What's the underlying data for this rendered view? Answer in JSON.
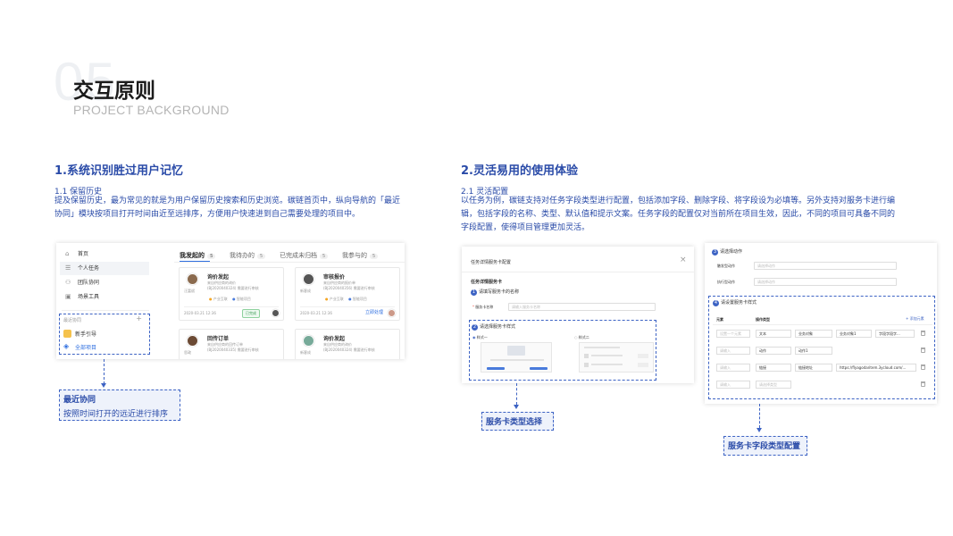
{
  "header": {
    "number": "05",
    "title": "交互原则",
    "subtitle": "PROJECT BACKGROUND"
  },
  "left": {
    "heading": "1.系统识别胜过用户记忆",
    "sub": "1.1 保留历史",
    "desc": "提及保留历史，最为常见的就是为用户保留历史搜索和历史浏览。碳链首页中，纵向导航的「最近协同」模块按项目打开时间由近至远排序，方便用户快速进到自己需要处理的项目中。",
    "callout": {
      "title": "最近协同",
      "text": "按照时间打开的远近进行排序"
    }
  },
  "ui1": {
    "nav": [
      "首页",
      "个人任务",
      "团队协同",
      "场景工具"
    ],
    "recent_label": "最近协同",
    "recent_add": "+",
    "recent_items": [
      "新手引导",
      "全部项目"
    ],
    "tabs": [
      {
        "label": "我发起的",
        "count": "5"
      },
      {
        "label": "我待办的",
        "count": "5"
      },
      {
        "label": "已完成未归档",
        "count": "5"
      },
      {
        "label": "我参与的",
        "count": "5"
      }
    ],
    "cards": [
      {
        "title": "询价发起",
        "line1": "来自供应商的询价",
        "line2": "(BJ2020040324) 需要进行审核",
        "person": "汪富斌",
        "tag1": "产业互联",
        "tag2": "智能项目",
        "date": "2020-03.21 12:36",
        "status": "已完成"
      },
      {
        "title": "审核报价",
        "line1": "来自供应商的报价单",
        "line2": "(BJ2020040356) 需要进行审核",
        "person": "新客成",
        "tag1": "产业互联",
        "tag2": "智能项目",
        "date": "2020-03.21 12:36",
        "status": "立即处理"
      },
      {
        "title": "回传订单",
        "line1": "来自供应商的回传订单",
        "line2": "(BJ2020040335) 需要进行审核",
        "person": "思政"
      },
      {
        "title": "询价发起",
        "line1": "来自供应商的询价",
        "line2": "(BJ2020040324) 需要进行审核",
        "person": "新客成"
      }
    ]
  },
  "right": {
    "heading": "2.灵活易用的使用体验",
    "sub": "2.1 灵活配置",
    "desc": "以任务为例，碳链支持对任务字段类型进行配置，包括添加字段、删除字段、将字段设为必填等。另外支持对服务卡进行编辑，包括字段的名称、类型、默认值和提示文案。任务字段的配置仅对当前所在项目生效，因此，不同的项目可具备不同的字段配置，使得项目管理更加灵活。",
    "callout1": "服务卡类型选择",
    "callout2": "服务卡字段类型配置"
  },
  "ui2": {
    "dialog_title": "任务详情服务卡配置",
    "close": "×",
    "section": "任务详情服务卡",
    "step1": "请填写服务卡的名称",
    "name_label": "服务卡名称",
    "name_placeholder": "请输入服务卡名称",
    "step2": "请选择服务卡样式",
    "style1": "样式一",
    "style2": "样式二"
  },
  "ui3": {
    "step3": "请选择动作",
    "trigger_label": "触发型动作",
    "exec_label": "执行型动作",
    "select_placeholder": "请选择动作",
    "step4": "请设置服务卡样式",
    "col_element": "元素",
    "col_type": "操作类型",
    "add_field": "+ 添加元素",
    "rows": [
      [
        "设置一个元素",
        "文本",
        "业务对象",
        "业务对象1",
        "字段字段字..."
      ],
      [
        "请输入",
        "动作",
        "动作1",
        "",
        ""
      ],
      [
        "请输入",
        "链接",
        "链接地址",
        "https://flyagodaritem.3ycloud.com/...",
        ""
      ],
      [
        "请输入",
        "请选择类型",
        "",
        "",
        ""
      ]
    ]
  }
}
